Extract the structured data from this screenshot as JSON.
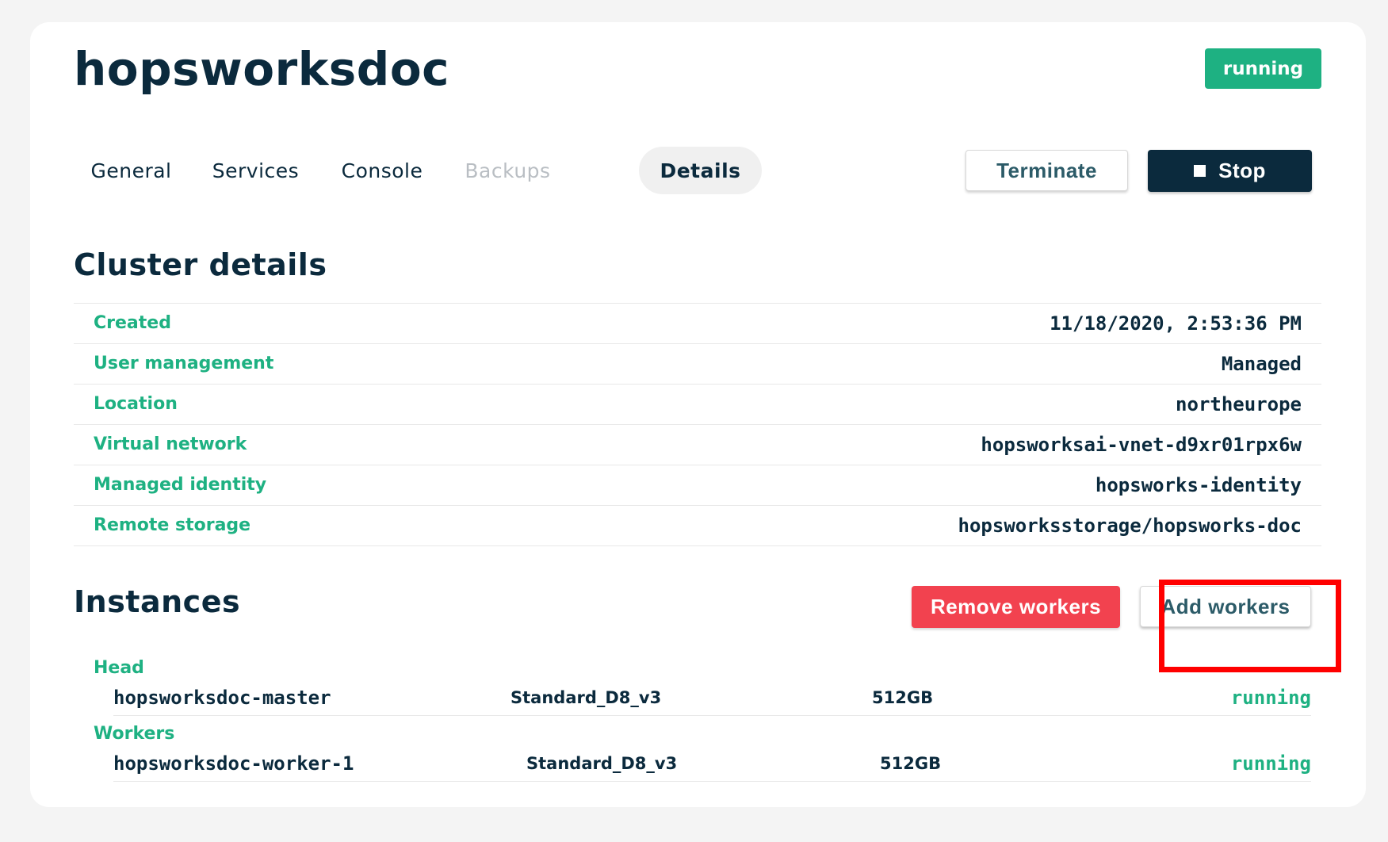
{
  "cluster": {
    "name": "hopsworksdoc",
    "status": "running"
  },
  "tabs": [
    {
      "label": "General",
      "state": "normal"
    },
    {
      "label": "Services",
      "state": "normal"
    },
    {
      "label": "Console",
      "state": "normal"
    },
    {
      "label": "Backups",
      "state": "disabled"
    },
    {
      "label": "Details",
      "state": "active"
    }
  ],
  "actions": {
    "terminate_label": "Terminate",
    "stop_label": "Stop"
  },
  "details": {
    "title": "Cluster details",
    "rows": [
      {
        "label": "Created",
        "value": "11/18/2020, 2:53:36 PM"
      },
      {
        "label": "User management",
        "value": "Managed"
      },
      {
        "label": "Location",
        "value": "northeurope"
      },
      {
        "label": "Virtual network",
        "value": "hopsworksai-vnet-d9xr01rpx6w"
      },
      {
        "label": "Managed identity",
        "value": "hopsworks-identity"
      },
      {
        "label": "Remote storage",
        "value": "hopsworksstorage/hopsworks-doc"
      }
    ]
  },
  "instances": {
    "title": "Instances",
    "remove_label": "Remove workers",
    "add_label": "Add workers",
    "head": {
      "label": "Head",
      "name": "hopsworksdoc-master",
      "type": "Standard_D8_v3",
      "disk": "512GB",
      "status": "running"
    },
    "workers": {
      "label": "Workers",
      "name": "hopsworksdoc-worker-1",
      "type": "Standard_D8_v3",
      "disk": "512GB",
      "status": "running"
    }
  },
  "colors": {
    "brand_green": "#1eb182",
    "navy": "#0b2a3d",
    "danger_red": "#f2424f",
    "highlight_red": "#ff0000"
  },
  "icons": {
    "stop": "stop-square-icon"
  }
}
